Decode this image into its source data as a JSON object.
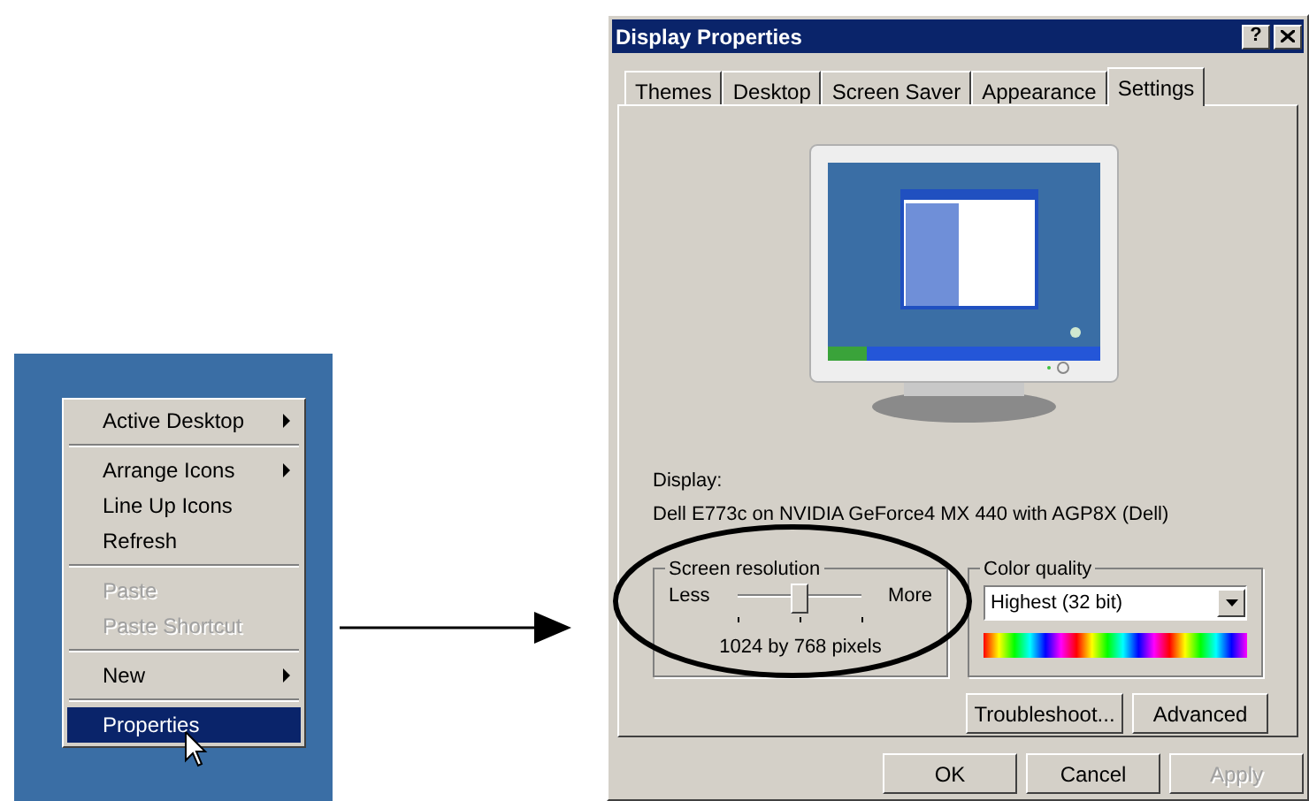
{
  "desktop_menu": {
    "items": [
      {
        "kind": "item",
        "label": "Active Desktop",
        "submenu": true,
        "disabled": false,
        "selected": false
      },
      {
        "kind": "separator"
      },
      {
        "kind": "item",
        "label": "Arrange Icons",
        "submenu": true,
        "disabled": false,
        "selected": false
      },
      {
        "kind": "item",
        "label": "Line Up Icons",
        "submenu": false,
        "disabled": false,
        "selected": false
      },
      {
        "kind": "item",
        "label": "Refresh",
        "submenu": false,
        "disabled": false,
        "selected": false
      },
      {
        "kind": "separator"
      },
      {
        "kind": "item",
        "label": "Paste",
        "submenu": false,
        "disabled": true,
        "selected": false
      },
      {
        "kind": "item",
        "label": "Paste Shortcut",
        "submenu": false,
        "disabled": true,
        "selected": false
      },
      {
        "kind": "separator"
      },
      {
        "kind": "item",
        "label": "New",
        "submenu": true,
        "disabled": false,
        "selected": false
      },
      {
        "kind": "separator"
      },
      {
        "kind": "item",
        "label": "Properties",
        "submenu": false,
        "disabled": false,
        "selected": true
      }
    ]
  },
  "dialog": {
    "title": "Display Properties",
    "help": "?",
    "tabs": [
      {
        "label": "Themes",
        "selected": false
      },
      {
        "label": "Desktop",
        "selected": false
      },
      {
        "label": "Screen Saver",
        "selected": false
      },
      {
        "label": "Appearance",
        "selected": false
      },
      {
        "label": "Settings",
        "selected": true
      }
    ],
    "display_label": "Display:",
    "display_name": "Dell E773c on NVIDIA GeForce4 MX 440 with AGP8X (Dell)",
    "resolution": {
      "title": "Screen resolution",
      "min_label": "Less",
      "max_label": "More",
      "level": 0.5,
      "reading": "1024 by 768 pixels"
    },
    "color_quality": {
      "title": "Color quality",
      "value": "Highest (32 bit)"
    },
    "panel_buttons": [
      {
        "label": "Troubleshoot...",
        "disabled": false
      },
      {
        "label": "Advanced",
        "disabled": false
      }
    ],
    "footer_buttons": [
      {
        "label": "OK",
        "disabled": false
      },
      {
        "label": "Cancel",
        "disabled": false
      },
      {
        "label": "Apply",
        "disabled": true
      }
    ]
  }
}
